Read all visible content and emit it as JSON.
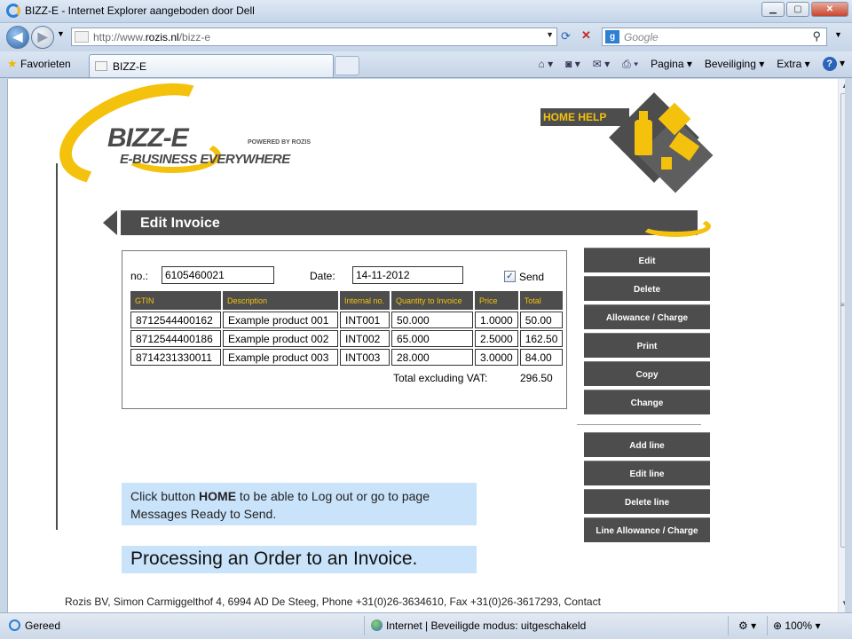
{
  "window": {
    "title": "BIZZ-E - Internet Explorer aangeboden door Dell",
    "minimize": "▁",
    "maximize": "▢",
    "close": "✕"
  },
  "address": {
    "url_prefix": "http://www.",
    "url_domain": "rozis.nl",
    "url_path": "/bizz-e",
    "search_placeholder": "Google"
  },
  "tabs": {
    "favorites_label": "Favorieten",
    "active_tab_label": "BIZZ-E"
  },
  "commandbar": {
    "page_label": "Pagina",
    "security_label": "Beveiliging",
    "extra_label": "Extra",
    "help_glyph": "?"
  },
  "logo": {
    "brand": "BIZZ-E",
    "powered": "POWERED BY ROZIS",
    "tagline": "E-BUSINESS EVERYWHERE"
  },
  "home_help": "HOME HELP",
  "page": {
    "header_title": "Edit Invoice"
  },
  "form": {
    "no_label": "no.:",
    "no_value": "6105460021",
    "date_label": "Date:",
    "date_value": "14-11-2012",
    "send_label": "Send",
    "send_checked": true,
    "columns": [
      "GTIN",
      "Description",
      "Internal no.",
      "Quantity to Invoice",
      "Price",
      "Total"
    ],
    "rows": [
      [
        "8712544400162",
        "Example product 001",
        "INT001",
        "50.000",
        "1.0000",
        "50.00"
      ],
      [
        "8712544400186",
        "Example product 002",
        "INT002",
        "65.000",
        "2.5000",
        "162.50"
      ],
      [
        "8714231330011",
        "Example product 003",
        "INT003",
        "28.000",
        "3.0000",
        "84.00"
      ]
    ],
    "total_label": "Total excluding VAT:",
    "total_value": "296.50"
  },
  "actions": {
    "edit": "Edit",
    "delete": "Delete",
    "allowance_charge": "Allowance / Charge",
    "print": "Print",
    "copy": "Copy",
    "change": "Change",
    "add_line": "Add line",
    "edit_line": "Edit line",
    "delete_line": "Delete line",
    "line_allowance_charge": "Line Allowance / Charge"
  },
  "notes": {
    "note1_pre": "Click button ",
    "note1_bold": "HOME",
    "note1_post": " to be able to Log out or go to page Messages Ready to Send.",
    "note2": "Processing an Order to an Invoice."
  },
  "footer": "Rozis BV, Simon Carmiggelthof 4, 6994 AD De Steeg, Phone +31(0)26-3634610, Fax +31(0)26-3617293, Contact",
  "status": {
    "ready": "Gereed",
    "zone": "Internet | Beveiligde modus: uitgeschakeld",
    "zoom": "100%"
  },
  "colors": {
    "brand_yellow": "#f4c20d",
    "dark_gray": "#4d4d4d",
    "note_blue": "#c9e3fb"
  }
}
